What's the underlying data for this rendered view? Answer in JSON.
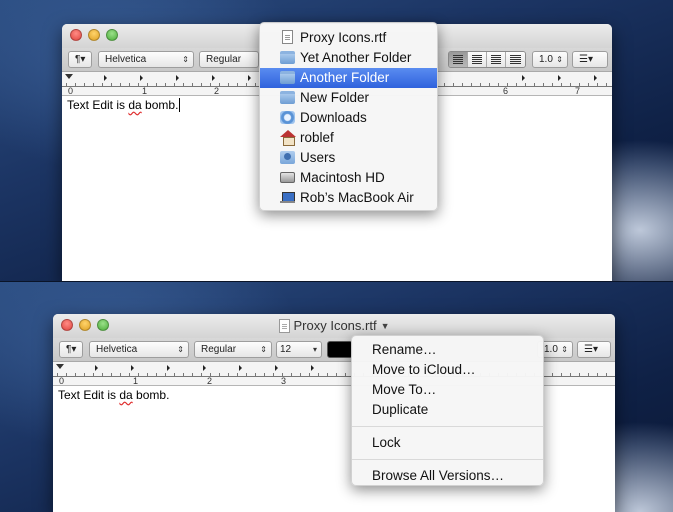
{
  "top_window": {
    "toolbar": {
      "paragraph_label": "¶▾",
      "font_family": "Helvetica",
      "font_style": "Regular",
      "line_spacing": "1.0",
      "list_label": "☰▾"
    },
    "ruler_numbers": [
      "0",
      "1",
      "2",
      "6",
      "7"
    ],
    "document_text_before": "Text Edit is ",
    "document_text_misspelled": "da",
    "document_text_after": " bomb."
  },
  "path_menu": {
    "items": [
      {
        "label": "Proxy Icons.rtf",
        "icon": "rtf-file-icon"
      },
      {
        "label": "Yet Another Folder",
        "icon": "folder-icon"
      },
      {
        "label": "Another Folder",
        "icon": "folder-icon",
        "highlighted": true
      },
      {
        "label": "New Folder",
        "icon": "folder-icon"
      },
      {
        "label": "Downloads",
        "icon": "downloads-folder-icon"
      },
      {
        "label": "roblef",
        "icon": "home-icon"
      },
      {
        "label": "Users",
        "icon": "users-folder-icon"
      },
      {
        "label": "Macintosh HD",
        "icon": "hard-drive-icon"
      },
      {
        "label": "Rob’s MacBook Air",
        "icon": "laptop-icon"
      }
    ]
  },
  "bottom_window": {
    "title": "Proxy Icons.rtf",
    "toolbar": {
      "paragraph_label": "¶▾",
      "font_family": "Helvetica",
      "font_style": "Regular",
      "font_size": "12",
      "line_spacing": "1.0",
      "list_label": "☰▾"
    },
    "ruler_numbers": [
      "0",
      "1",
      "2",
      "3"
    ],
    "document_text_before": "Text Edit is ",
    "document_text_misspelled": "da",
    "document_text_after": " bomb."
  },
  "title_menu": {
    "items": [
      "Rename…",
      "Move to iCloud…",
      "Move To…",
      "Duplicate"
    ],
    "lock": "Lock",
    "browse": "Browse All Versions…"
  },
  "colors": {
    "menu_highlight": "#2f62dd",
    "misspelling_underline": "#e03030"
  }
}
